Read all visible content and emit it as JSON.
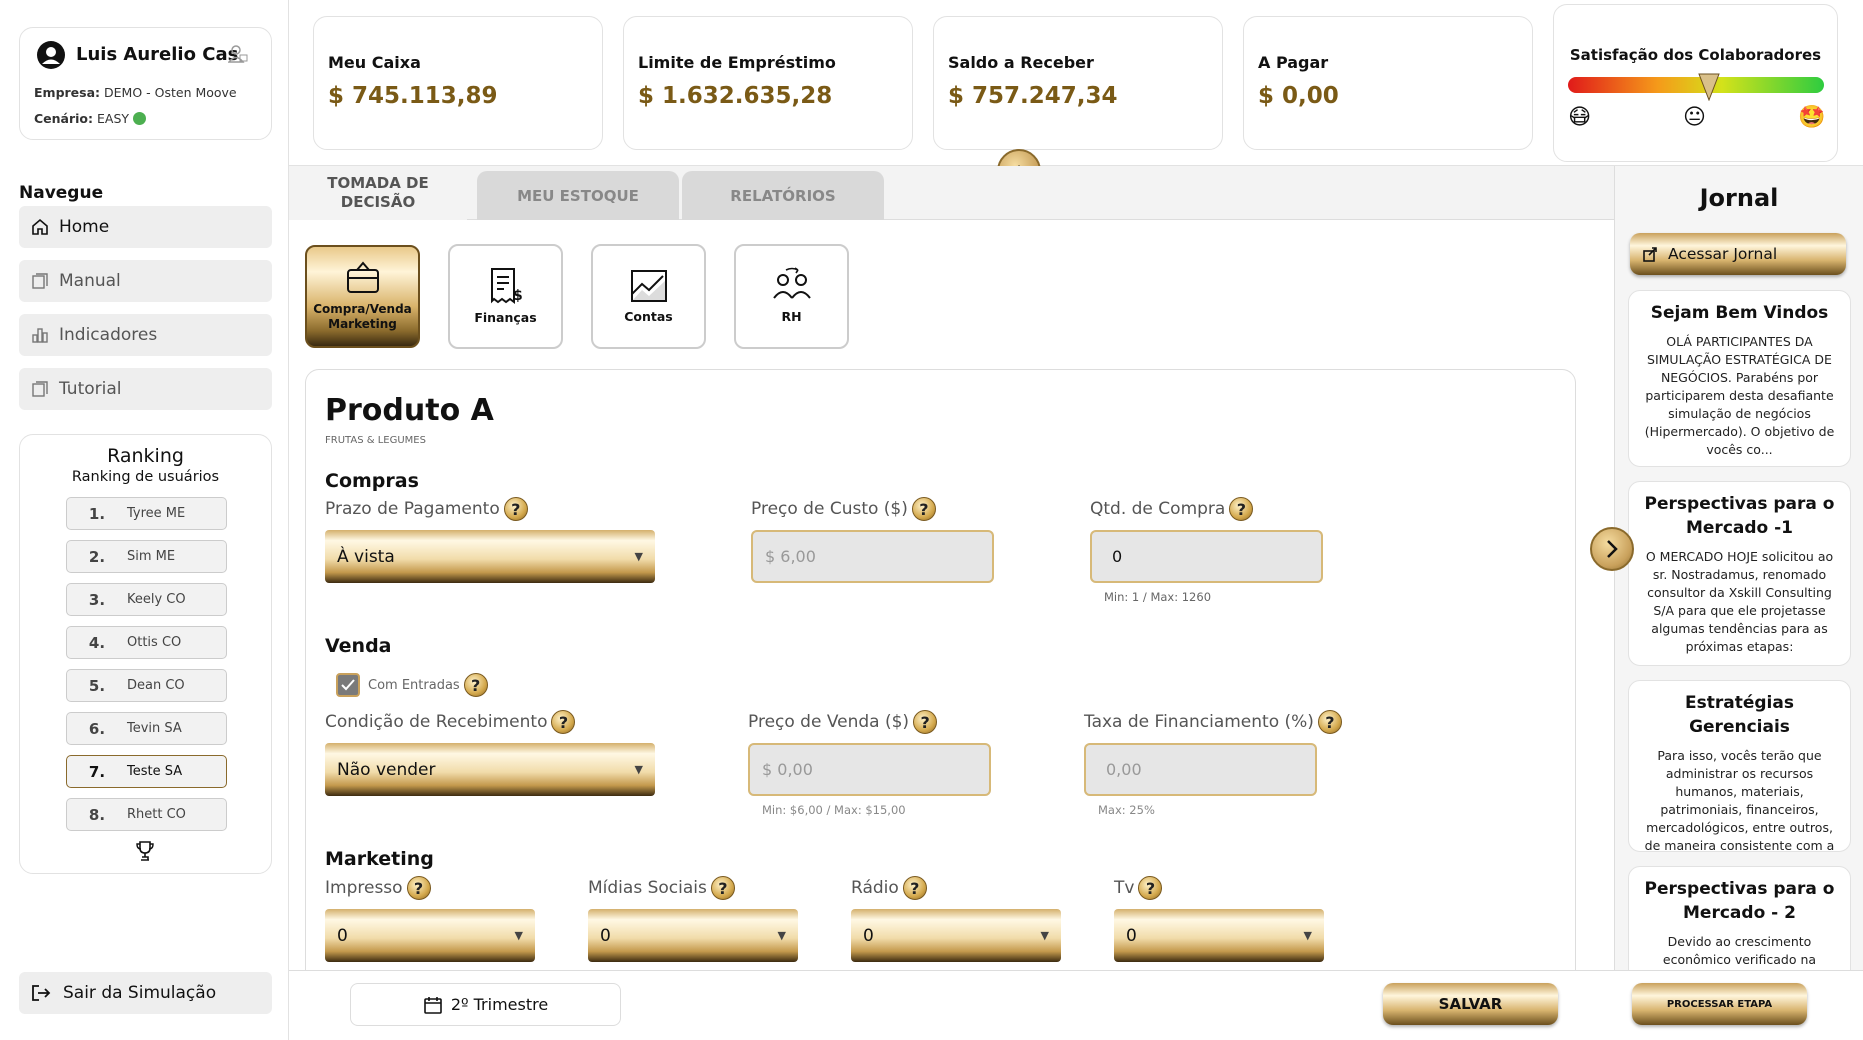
{
  "user": {
    "name": "Luis Aurelio Cas",
    "company_label": "Empresa:",
    "company": "DEMO - Osten Moove",
    "scenario_label": "Cenário:",
    "scenario": "EASY",
    "status_color": "#4caf50"
  },
  "nav": {
    "title": "Navegue",
    "items": [
      {
        "label": "Home",
        "icon": "home-icon"
      },
      {
        "label": "Manual",
        "icon": "book-icon"
      },
      {
        "label": "Indicadores",
        "icon": "chart-icon"
      },
      {
        "label": "Tutorial",
        "icon": "book-icon"
      }
    ]
  },
  "ranking": {
    "title": "Ranking",
    "subtitle": "Ranking de usuários",
    "items": [
      {
        "pos": "1.",
        "name": "Tyree ME"
      },
      {
        "pos": "2.",
        "name": "Sim ME"
      },
      {
        "pos": "3.",
        "name": "Keely CO"
      },
      {
        "pos": "4.",
        "name": "Ottis CO"
      },
      {
        "pos": "5.",
        "name": "Dean CO"
      },
      {
        "pos": "6.",
        "name": "Tevin SA"
      },
      {
        "pos": "7.",
        "name": "Teste SA"
      },
      {
        "pos": "8.",
        "name": "Rhett CO"
      }
    ]
  },
  "logout": "Sair da Simulação",
  "kpis": [
    {
      "label": "Meu Caixa",
      "value": "$ 745.113,89"
    },
    {
      "label": "Limite de Empréstimo",
      "value": "$ 1.632.635,28"
    },
    {
      "label": "Saldo a Receber",
      "value": "$ 757.247,34"
    },
    {
      "label": "A Pagar",
      "value": "$ 0,00"
    }
  ],
  "satisfaction": {
    "title": "Satisfação dos Colaboradores",
    "level": 0.55
  },
  "tabs": [
    "TOMADA DE DECISÃO",
    "MEU ESTOQUE",
    "RELATÓRIOS"
  ],
  "categories": [
    {
      "label": "Compra/Venda Marketing"
    },
    {
      "label": "Finanças"
    },
    {
      "label": "Contas"
    },
    {
      "label": "RH"
    }
  ],
  "product": {
    "title": "Produto A",
    "subtitle": "FRUTAS & LEGUMES",
    "compras": {
      "title": "Compras",
      "prazo_label": "Prazo de Pagamento",
      "prazo_value": "À vista",
      "custo_label": "Preço de Custo ($)",
      "custo_value": "$  6,00",
      "qtd_label": "Qtd. de Compra",
      "qtd_value": "0",
      "qtd_hint": "Min: 1 / Max: 1260"
    },
    "venda": {
      "title": "Venda",
      "entradas_label": "Com Entradas",
      "cond_label": "Condição de Recebimento",
      "cond_value": "Não vender",
      "preco_label": "Preço de Venda ($)",
      "preco_value": "$  0,00",
      "preco_hint": "Min: $6,00 / Max: $15,00",
      "taxa_label": "Taxa de Financiamento (%)",
      "taxa_value": "0,00",
      "taxa_hint": "Max: 25%"
    },
    "marketing": {
      "title": "Marketing",
      "fields": [
        {
          "label": "Impresso",
          "value": "0"
        },
        {
          "label": "Mídias Sociais",
          "value": "0"
        },
        {
          "label": "Rádio",
          "value": "0"
        },
        {
          "label": "Tv",
          "value": "0"
        }
      ]
    }
  },
  "footer": {
    "period": "2º Trimestre",
    "save": "SALVAR",
    "process": "PROCESSAR ETAPA"
  },
  "jornal": {
    "title": "Jornal",
    "button": "Acessar Jornal",
    "news": [
      {
        "title": "Sejam Bem Vindos",
        "text": "OLÁ PARTICIPANTES DA SIMULAÇÃO ESTRATÉGICA DE NEGÓCIOS. Parabéns por participarem desta desafiante simulação de negócios (Hipermercado). O objetivo de vocês co..."
      },
      {
        "title": "Perspectivas para o Mercado -1",
        "text": "O MERCADO HOJE solicitou ao sr. Nostradamus, renomado consultor da Xskill Consulting S/A para que ele projetasse algumas tendências para as próximas etapas:"
      },
      {
        "title": "Estratégias Gerenciais",
        "text": "Para isso, vocês terão que administrar os recursos humanos, materiais, patrimoniais, financeiros, mercadológicos, entre outros, de maneira consistente com a ade..."
      },
      {
        "title": "Perspectivas para o Mercado - 2",
        "text": "Devido ao crescimento econômico verificado na economia do país, o nosso"
      }
    ]
  },
  "colors": {
    "gold": "#c9a15c",
    "money": "#7a5a16"
  }
}
